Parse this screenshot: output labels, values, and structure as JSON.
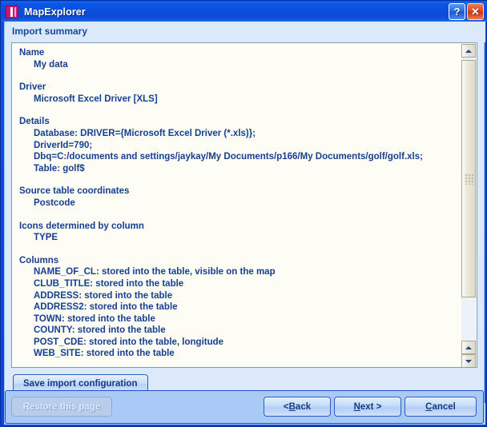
{
  "window": {
    "title": "MapExplorer",
    "app_icon": "mapexplorer-icon",
    "help_label": "?",
    "close_label": "✕",
    "accent_color": "#0a4fdc",
    "title_bar_color": "#0b4fdf",
    "client_color": "#dce9fb"
  },
  "page": {
    "title": "Import summary"
  },
  "summary": {
    "text_color": "#173f8f",
    "background_color": "#fdfdf5",
    "sections": [
      {
        "heading": "Name",
        "items": [
          "My data"
        ]
      },
      {
        "heading": "Driver",
        "items": [
          "Microsoft Excel Driver [XLS]"
        ]
      },
      {
        "heading": "Details",
        "items": [
          "Database: DRIVER={Microsoft Excel Driver (*.xls)};",
          "DriverId=790;",
          "Dbq=C:/documents and settings/jaykay/My Documents/p166/My Documents/golf/golf.xls;",
          "Table: golf$"
        ]
      },
      {
        "heading": "Source table coordinates",
        "items": [
          "Postcode"
        ]
      },
      {
        "heading": "Icons determined by column",
        "items": [
          "TYPE"
        ]
      },
      {
        "heading": "Columns",
        "items": [
          "NAME_OF_CL: stored into the table, visible on the map",
          "CLUB_TITLE: stored into the table",
          "ADDRESS: stored into the table",
          "ADDRESS2: stored into the table",
          "TOWN: stored into the table",
          "COUNTY: stored into the table",
          "POST_CDE: stored into the table, longitude",
          "WEB_SITE: stored into the table"
        ]
      }
    ]
  },
  "scrollbar": {
    "orientation": "vertical",
    "up_arrow": "scroll-up-arrow",
    "down_arrow": "scroll-down-arrow",
    "thumb_position_percent": 5,
    "thumb_size_percent": 73
  },
  "actions": {
    "save_config": "Save import configuration",
    "restore_page": "Restore this page",
    "restore_page_enabled": false,
    "back_prefix": "< ",
    "back_mnemonic": "B",
    "back_suffix": "ack",
    "next_mnemonic": "N",
    "next_suffix": "ext >",
    "cancel_mnemonic": "C",
    "cancel_suffix": "ancel"
  }
}
